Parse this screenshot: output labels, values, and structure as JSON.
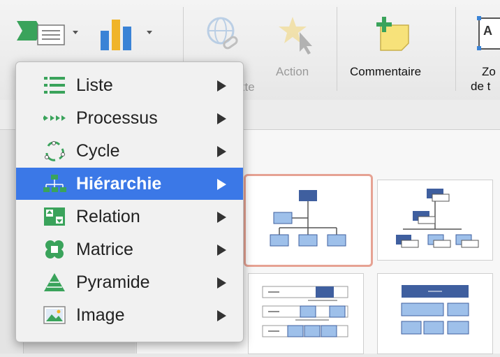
{
  "ribbon": {
    "action_label": "Action",
    "partial_label": "xte",
    "comment_label": "Commentaire",
    "zone_label_line1": "Zo",
    "zone_label_line2": "de t"
  },
  "menu": {
    "items": [
      {
        "label": "Liste",
        "icon": "list-icon"
      },
      {
        "label": "Processus",
        "icon": "process-arrows-icon"
      },
      {
        "label": "Cycle",
        "icon": "cycle-icon"
      },
      {
        "label": "Hiérarchie",
        "icon": "hierarchy-icon",
        "selected": true
      },
      {
        "label": "Relation",
        "icon": "relation-icon"
      },
      {
        "label": "Matrice",
        "icon": "matrix-icon"
      },
      {
        "label": "Pyramide",
        "icon": "pyramid-icon"
      },
      {
        "label": "Image",
        "icon": "image-icon"
      }
    ]
  },
  "colors": {
    "selection_blue": "#3b78e7",
    "selected_thumb_border": "#e6a293",
    "node_dark": "#3f5f9f",
    "node_light": "#9ec0ea"
  }
}
